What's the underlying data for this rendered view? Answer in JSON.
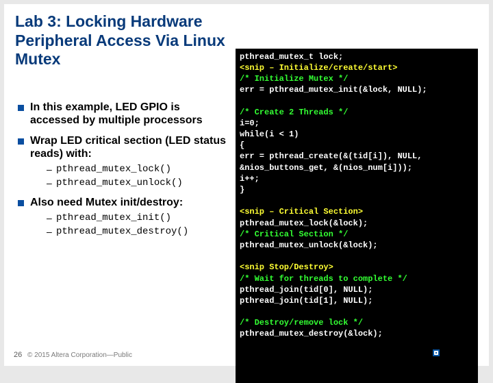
{
  "title": "Lab 3: Locking Hardware Peripheral Access Via Linux Mutex",
  "bullets": [
    {
      "text": "In this example, LED GPIO is accessed by multiple processors"
    },
    {
      "text": "Wrap LED critical section (LED status reads) with:",
      "sub": [
        "pthread_mutex_lock()",
        "pthread_mutex_unlock()"
      ]
    },
    {
      "text": "Also need Mutex init/destroy:",
      "sub": [
        "pthread_mutex_init()",
        "pthread_mutex_destroy()"
      ]
    }
  ],
  "code": {
    "l0": "   pthread_mutex_t lock;",
    "s1": "<snip – Initialize/create/start>",
    "l1a": "   /* Initialize Mutex */",
    "l1b": "   err = pthread_mutex_init(&lock, NULL);",
    "c2": "   /* Create 2 Threads */",
    "l2a": "   i=0;",
    "l2b": "   while(i < 1)",
    "l2c": "   {",
    "l2d": "     err = pthread_create(&(tid[i]), NULL,",
    "l2e": "           &nios_buttons_get, &(nios_num[i]));",
    "l2f": "     i++;",
    "l2g": "   }",
    "s3": "<snip – Critical Section>",
    "l3a": "   pthread_mutex_lock(&lock);",
    "l3b": "   /* Critical Section */",
    "l3c": "   pthread_mutex_unlock(&lock);",
    "s4": "<snip Stop/Destroy>",
    "c4": "   /* Wait for threads to complete */",
    "l4a": "   pthread_join(tid[0], NULL);",
    "l4b": "   pthread_join(tid[1], NULL);",
    "c5": "   /* Destroy/remove lock */",
    "l5a": "   pthread_mutex_destroy(&lock);"
  },
  "slide_number": "26",
  "copyright": "© 2015 Altera Corporation—Public",
  "logo_text": ""
}
